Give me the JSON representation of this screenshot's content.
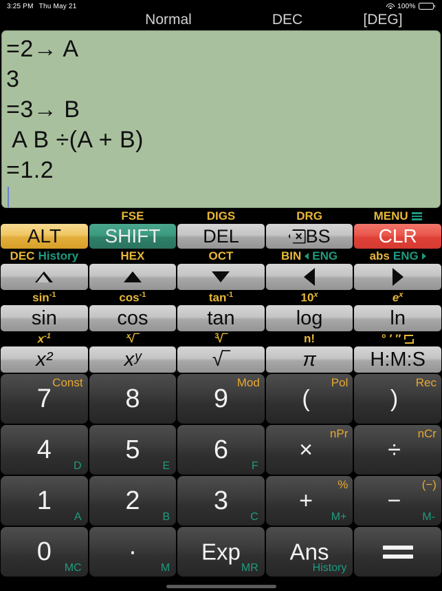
{
  "status": {
    "time": "3:25 PM",
    "date": "Thu May 21",
    "battery_percent": "100%",
    "wifi_icon": "wifi-icon",
    "battery_icon": "battery-icon"
  },
  "modes": {
    "calc_mode": "Normal",
    "base_mode": "DEC",
    "angle_mode": "[DEG]"
  },
  "display": {
    "lines": [
      "=2→ A",
      "3",
      "=3→ B",
      " A B ÷(A + B)",
      "=1.2"
    ],
    "cursor_visible": true,
    "background_color": "#a9c09e"
  },
  "colors": {
    "alt_key": "#e2ae3c",
    "shift_key": "#2f8068",
    "clr_key": "#df4138",
    "gold_label": "#e8b838",
    "teal_label": "#1f9b7f",
    "dark_key": "#303030",
    "gray_key": "#b4b4b4"
  },
  "keypad": {
    "row_fn": {
      "labels": [
        {
          "gold": "",
          "teal": ""
        },
        {
          "gold": "FSE",
          "teal": ""
        },
        {
          "gold": "DIGS",
          "teal": ""
        },
        {
          "gold": "DRG",
          "teal": ""
        },
        {
          "gold": "MENU",
          "teal": "",
          "icon": "hamburger-menu-icon"
        }
      ],
      "keys": [
        "ALT",
        "SHIFT",
        "DEL",
        "BS",
        "CLR"
      ]
    },
    "row_nav": {
      "labels": [
        {
          "gold": "DEC",
          "teal": "History"
        },
        {
          "gold": "HEX",
          "teal": ""
        },
        {
          "gold": "OCT",
          "teal": ""
        },
        {
          "gold": "BIN",
          "teal": "ENG",
          "teal_arrow": "left"
        },
        {
          "gold": "abs",
          "teal": "ENG",
          "teal_arrow": "right"
        }
      ],
      "keys": [
        "triangle-up-hollow",
        "triangle-up",
        "triangle-down",
        "triangle-left",
        "triangle-right"
      ]
    },
    "row_trig": {
      "labels": [
        "sin-1",
        "cos-1",
        "tan-1",
        "10x",
        "ex"
      ],
      "labels_text": [
        {
          "base": "sin",
          "sup": "-1"
        },
        {
          "base": "cos",
          "sup": "-1"
        },
        {
          "base": "tan",
          "sup": "-1"
        },
        {
          "base": "10",
          "sup": "x"
        },
        {
          "base": "e",
          "sup": "x"
        }
      ],
      "keys": [
        "sin",
        "cos",
        "tan",
        "log",
        "ln"
      ]
    },
    "row_pow": {
      "labels_text": [
        {
          "base": "x",
          "sup": "-1"
        },
        {
          "pre": "x",
          "base": "√‾"
        },
        {
          "pre": "3",
          "base": "√‾"
        },
        {
          "base": "n!",
          "sup": ""
        },
        {
          "base": "° ′ ″",
          "icon": "swap-icon"
        }
      ],
      "keys": [
        "x²",
        "xʸ",
        "√‾",
        "π",
        "H:M:S"
      ]
    },
    "row_789": [
      {
        "main": "7",
        "gold": "Const",
        "teal": ""
      },
      {
        "main": "8",
        "gold": "",
        "teal": ""
      },
      {
        "main": "9",
        "gold": "Mod",
        "teal": ""
      },
      {
        "main": "(",
        "gold": "Pol",
        "teal": ""
      },
      {
        "main": ")",
        "gold": "Rec",
        "teal": ""
      }
    ],
    "row_456": [
      {
        "main": "4",
        "gold": "",
        "teal": "D"
      },
      {
        "main": "5",
        "gold": "",
        "teal": "E"
      },
      {
        "main": "6",
        "gold": "",
        "teal": "F"
      },
      {
        "main": "×",
        "gold": "nPr",
        "teal": ""
      },
      {
        "main": "÷",
        "gold": "nCr",
        "teal": ""
      }
    ],
    "row_123": [
      {
        "main": "1",
        "gold": "",
        "teal": "A"
      },
      {
        "main": "2",
        "gold": "",
        "teal": "B"
      },
      {
        "main": "3",
        "gold": "",
        "teal": "C"
      },
      {
        "main": "+",
        "gold": "%",
        "teal": "M+"
      },
      {
        "main": "−",
        "gold": "(−)",
        "teal": "M-"
      }
    ],
    "row_0": [
      {
        "main": "0",
        "gold": "",
        "teal": "MC"
      },
      {
        "main": "·",
        "gold": "",
        "teal": "M"
      },
      {
        "main": "Exp",
        "gold": "",
        "teal": "MR"
      },
      {
        "main": "Ans",
        "gold": "",
        "teal": "History"
      },
      {
        "main": "=",
        "gold": "",
        "teal": ""
      }
    ]
  }
}
